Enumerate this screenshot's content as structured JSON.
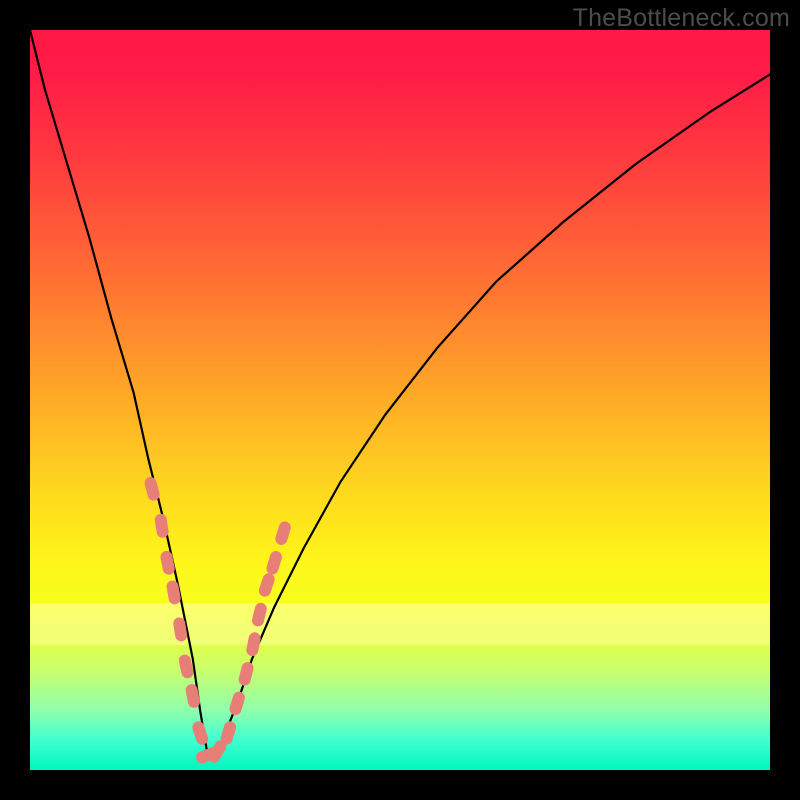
{
  "watermark": "TheBottleneck.com",
  "colors": {
    "frame": "#000000",
    "curve": "#000000",
    "marker": "#e77f78",
    "gradient_top": "#ff1945",
    "gradient_bottom": "#00f7bf"
  },
  "chart_data": {
    "type": "line",
    "title": "",
    "xlabel": "",
    "ylabel": "",
    "xlim": [
      0,
      100
    ],
    "ylim": [
      0,
      100
    ],
    "note": "Axes carry no numeric tick labels in the source; x and y are expressed as 0–100 percent of the plot area. The curve is a V-shaped bottleneck profile with minimum near x≈24. Pink lozenge markers cluster along both arms near the trough.",
    "series": [
      {
        "name": "bottleneck-curve",
        "x": [
          0,
          2,
          5,
          8,
          11,
          14,
          16,
          18,
          20,
          22,
          23,
          24,
          25,
          26,
          28,
          30,
          33,
          37,
          42,
          48,
          55,
          63,
          72,
          82,
          92,
          100
        ],
        "y": [
          100,
          92,
          82,
          72,
          61,
          51,
          42,
          34,
          25,
          15,
          8,
          2,
          2,
          4,
          9,
          15,
          22,
          30,
          39,
          48,
          57,
          66,
          74,
          82,
          89,
          94
        ]
      }
    ],
    "markers": [
      {
        "x": 16.5,
        "y": 38
      },
      {
        "x": 17.8,
        "y": 33
      },
      {
        "x": 18.6,
        "y": 28
      },
      {
        "x": 19.4,
        "y": 24
      },
      {
        "x": 20.3,
        "y": 19
      },
      {
        "x": 21.1,
        "y": 14
      },
      {
        "x": 22.0,
        "y": 10
      },
      {
        "x": 23.0,
        "y": 5
      },
      {
        "x": 24.0,
        "y": 2
      },
      {
        "x": 25.3,
        "y": 2.5
      },
      {
        "x": 26.8,
        "y": 5
      },
      {
        "x": 28.0,
        "y": 9
      },
      {
        "x": 29.2,
        "y": 13
      },
      {
        "x": 30.2,
        "y": 17
      },
      {
        "x": 31.0,
        "y": 21
      },
      {
        "x": 32.0,
        "y": 25
      },
      {
        "x": 33.0,
        "y": 28
      },
      {
        "x": 34.2,
        "y": 32
      }
    ],
    "bands": [
      {
        "name": "pale-yellow-band",
        "y0": 77,
        "y1": 83
      }
    ]
  }
}
